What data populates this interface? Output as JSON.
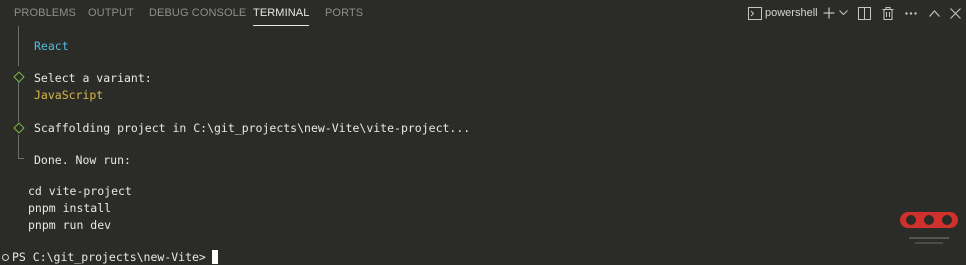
{
  "tabs": [
    {
      "label": "PROBLEMS"
    },
    {
      "label": "OUTPUT"
    },
    {
      "label": "DEBUG CONSOLE"
    },
    {
      "label": "TERMINAL"
    },
    {
      "label": "PORTS"
    }
  ],
  "active_tab": "TERMINAL",
  "toolbar": {
    "shell_name": "powershell",
    "icons": [
      "terminal-icon",
      "add-icon",
      "chevron-down-icon",
      "split-icon",
      "trash-icon",
      "more-icon",
      "chevron-up-icon",
      "close-icon"
    ]
  },
  "terminal": {
    "framework_value": "React",
    "variant_prompt": "Select a variant:",
    "variant_value": "JavaScript",
    "scaffold_message": "Scaffolding project in C:\\git_projects\\new-Vite\\vite-project...",
    "done_message": "Done. Now run:",
    "commands": [
      "cd vite-project",
      "pnpm install",
      "pnpm run dev"
    ],
    "prompt": "PS C:\\git_projects\\new-Vite> "
  },
  "colors": {
    "background": "#2b2b28",
    "accent_cyan": "#56bdd9",
    "accent_yellow": "#d9b84a",
    "diamond_green": "#7dbb42",
    "logo_red": "#d0312d"
  }
}
